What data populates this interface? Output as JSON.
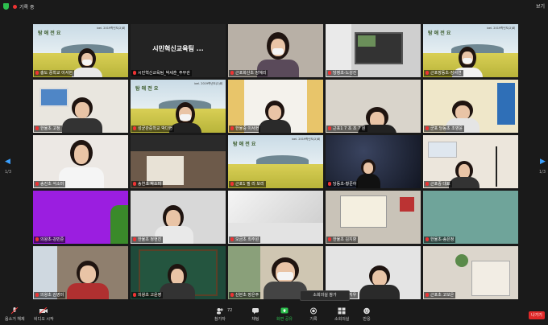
{
  "topbar": {
    "recording_label": "기록 중",
    "view_label": "보기"
  },
  "popup": {
    "label": "소회의실 참가"
  },
  "slide": {
    "brand": "탐 애 전 요",
    "subtitle": "ixel. 2019학년도(2)회",
    "title_text": "시민혁신교육팀 ..."
  },
  "pagination": {
    "left": "1/3",
    "right": "1/3"
  },
  "tiles": [
    {
      "name": "충도 중학교 이서현"
    },
    {
      "name": "시민혁신교육팀_박세훈_주무관"
    },
    {
      "name": "근포화산초 장혜리"
    },
    {
      "name": "당정초-노성진"
    },
    {
      "name": "근포장동초-장서연"
    },
    {
      "name": "한율초 고정"
    },
    {
      "name": "성균관중학교 박다현"
    },
    {
      "name": "한율중 이서현"
    },
    {
      "name": "근포1 7 초 조 7 원"
    },
    {
      "name": "군포 당동초 조영윤"
    },
    {
      "name": "송진초 석소미"
    },
    {
      "name": "송연초 박소미"
    },
    {
      "name": "근포1 필 리 보리"
    },
    {
      "name": "당동초-황준하"
    },
    {
      "name": "근포중 대표"
    },
    {
      "name": "의왕초-강민준"
    },
    {
      "name": "한율초 정현진"
    },
    {
      "name": "오금초 최주원"
    },
    {
      "name": "한율초 김지향"
    },
    {
      "name": "한율초-송은정"
    },
    {
      "name": "의왕초 김영미"
    },
    {
      "name": "의왕초 고윤영"
    },
    {
      "name": "산본초 장은주"
    },
    {
      "name": "근포초 김지우"
    },
    {
      "name": "근포초 고보은"
    }
  ],
  "toolbar": {
    "mute": "음소거 해제",
    "video": "비디오 시작",
    "participants": "참가자",
    "participants_count": "72",
    "chat": "채팅",
    "share": "화면 공유",
    "record": "기록",
    "breakout": "소회의실",
    "reactions": "반응",
    "leave": "나가기"
  }
}
